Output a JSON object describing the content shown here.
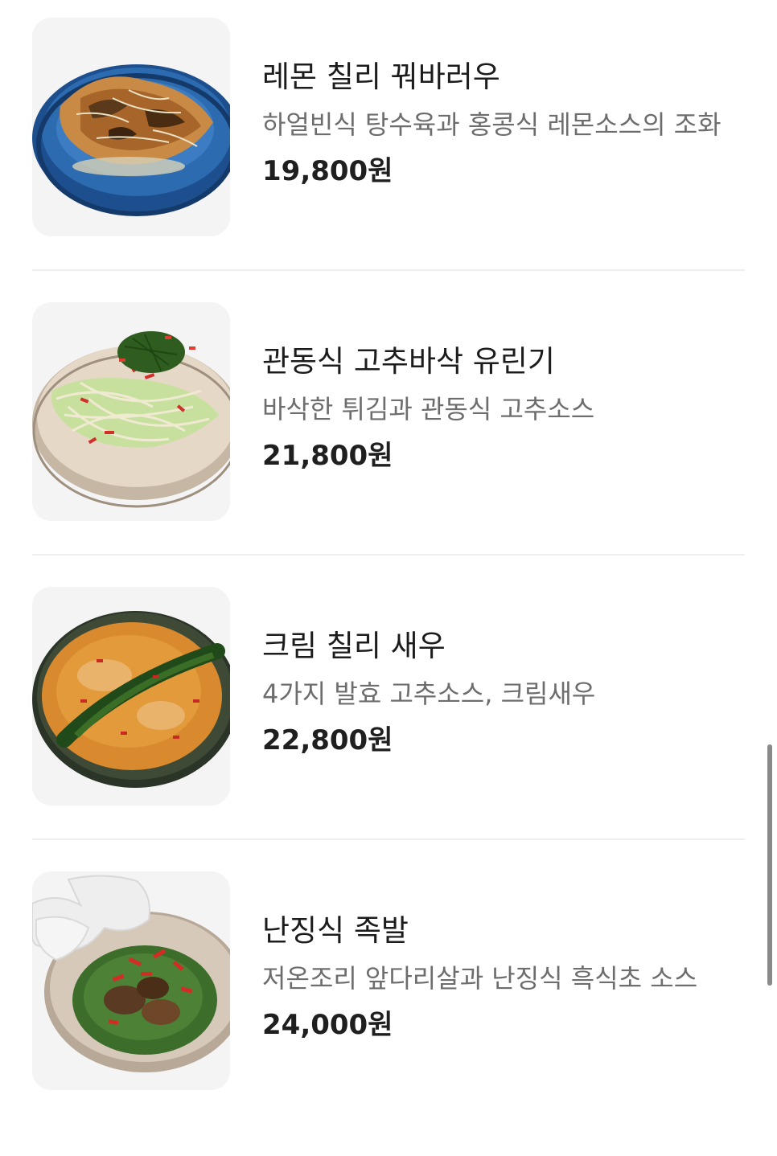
{
  "menu": {
    "items": [
      {
        "name": "레몬 칠리 꿔바러우",
        "description": "하얼빈식 탕수육과 홍콩식 레몬소스의 조화",
        "price": "19,800원",
        "image_icon": "fried-pork-on-blue-plate"
      },
      {
        "name": "관동식 고추바삭 유린기",
        "description": "바삭한 튀김과 관동식 고추소스",
        "price": "21,800원",
        "image_icon": "fried-chicken-salad-on-beige-plate"
      },
      {
        "name": "크림 칠리 새우",
        "description": "4가지 발효 고추소스, 크림새우",
        "price": "22,800원",
        "image_icon": "cream-chili-shrimp-on-green-plate"
      },
      {
        "name": "난징식 족발",
        "description": "저온조리 앞다리살과 난징식 흑식초 소스",
        "price": "24,000원",
        "image_icon": "pork-hock-with-rice-crisps"
      }
    ]
  },
  "colors": {
    "background": "#ffffff",
    "thumb_background": "#f4f4f4",
    "name_text": "#1c1c1c",
    "description_text": "#6d6d6d",
    "price_text": "#1f1f1f",
    "divider": "#efefef",
    "scrollbar": "#8a8a8a"
  }
}
